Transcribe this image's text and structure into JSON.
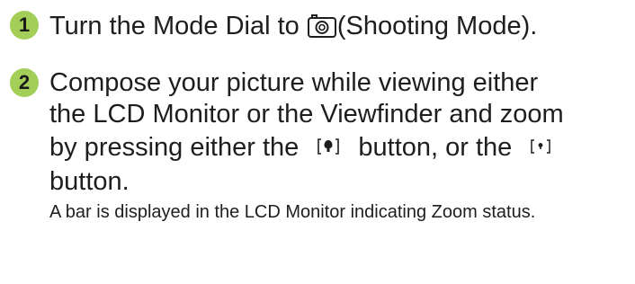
{
  "steps": [
    {
      "number": "1",
      "text_before_icon": "Turn the Mode Dial to",
      "icon": "camera-shooting-mode-icon",
      "text_after_icon": "(Shooting Mode)."
    },
    {
      "number": "2",
      "line1": "Compose your picture while viewing either",
      "line2": "the LCD Monitor or the Viewfinder and zoom",
      "line3_part1": "by pressing either the",
      "telephoto_icon": "telephoto-zoom-icon",
      "line3_part2": "button, or the",
      "wide_icon": "wide-angle-zoom-icon",
      "line4": "button.",
      "note": "A bar is displayed in the LCD Monitor indicating Zoom status."
    }
  ],
  "colors": {
    "badge": "#a3cf59",
    "text": "#1e1e1e"
  }
}
